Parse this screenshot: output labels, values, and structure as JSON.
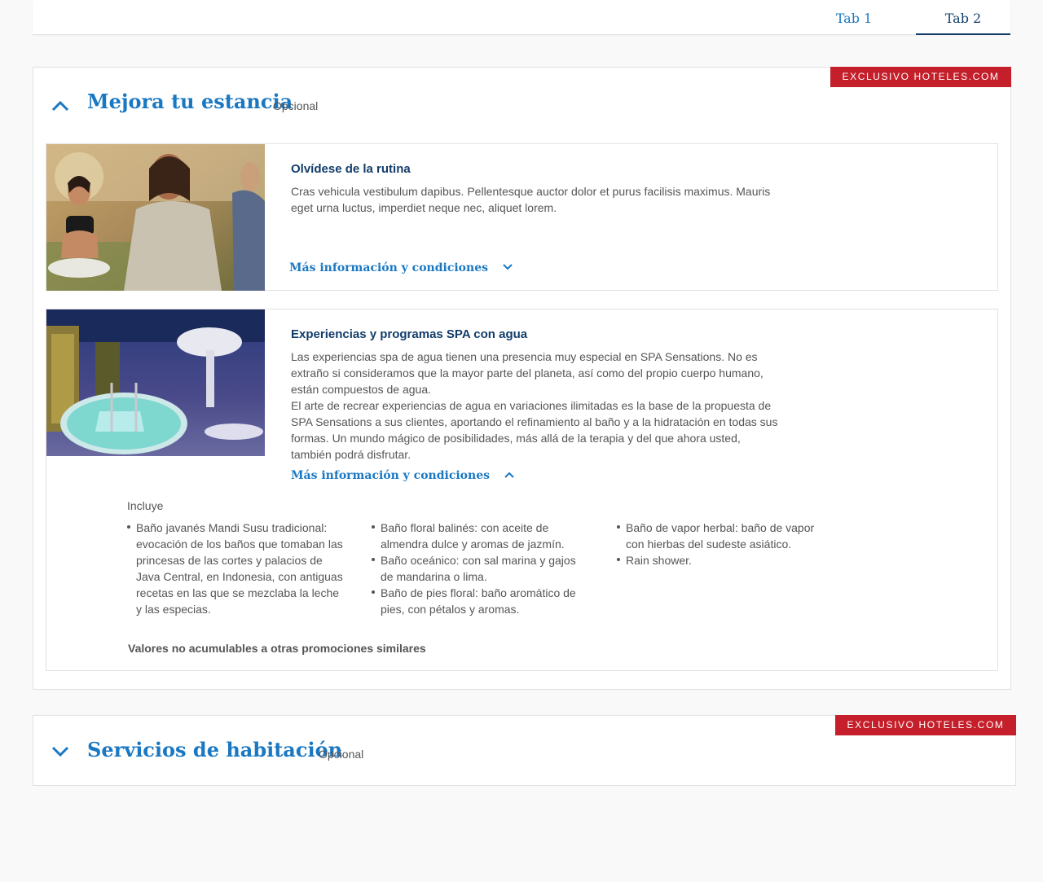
{
  "tabs": [
    {
      "label": "Tab 1"
    },
    {
      "label": "Tab 2"
    }
  ],
  "sections": [
    {
      "badge": "EXCLUSIVO HOTELES.COM",
      "title": "Mejora tu estancia",
      "optional": "Opcional",
      "expanded": true,
      "cards": [
        {
          "title": "Olvídese de la rutina",
          "description": "Cras vehicula vestibulum dapibus. Pellentesque auctor dolor et purus facilisis maximus. Mauris eget urna luctus, imperdiet neque nec, aliquet lorem.",
          "more_label": "Más información y condiciones",
          "image_icon": "yoga-photo"
        },
        {
          "title": "Experiencias y programas SPA con agua",
          "description_p1": "Las experiencias spa de agua tienen una presencia muy especial en SPA Sensations. No es extraño si consideramos que la mayor parte del planeta, así como del propio cuerpo humano, están compuestos de agua.",
          "description_p2": "El arte de recrear experiencias de agua en variaciones ilimitadas es la base de la propuesta de SPA Sensations a sus clientes, aportando el refinamiento al baño y a la hidratación en todas sus formas. Un mundo mágico de posibilidades, más allá de la terapia y del que ahora usted, también podrá disfrutar.",
          "more_label": "Más información y condiciones",
          "image_icon": "spa-pool-photo",
          "includes_label": "Incluye",
          "includes_col1": [
            "Baño javanés Mandi Susu tradicional: evocación de los baños que tomaban las princesas de las cortes y palacios de Java Central, en Indonesia, con antiguas recetas en las que se mezclaba la leche y las especias."
          ],
          "includes_col2": [
            "Baño floral balinés: con aceite de almendra dulce y aromas de jazmín.",
            "Baño oceánico: con sal marina y gajos de mandarina o lima.",
            "Baño de pies floral: baño aromático de pies, con pétalos y aromas."
          ],
          "includes_col3": [
            "Baño de vapor herbal: baño de vapor con hierbas del sudeste asiático.",
            "Rain shower."
          ],
          "footnote": "Valores no acumulables a otras promociones similares"
        }
      ]
    },
    {
      "badge": "EXCLUSIVO HOTELES.COM",
      "title": "Servicios de habitación",
      "optional": "Opcional",
      "expanded": false
    }
  ],
  "colors": {
    "link_blue": "#1a78c2",
    "dark_navy": "#123d6a",
    "badge_red": "#c41f2a",
    "page_bg": "#f9f9f9"
  }
}
